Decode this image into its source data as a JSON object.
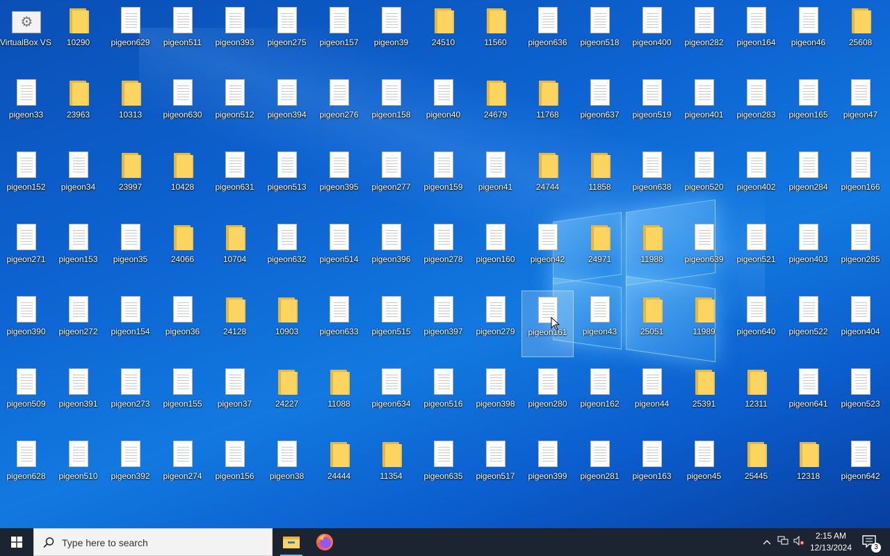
{
  "desktop": {
    "columns": [
      {
        "items": [
          {
            "label": "VirtualBox VS Studio",
            "type": "settings"
          },
          {
            "label": "pigeon33",
            "type": "file"
          },
          {
            "label": "pigeon152",
            "type": "file"
          },
          {
            "label": "pigeon271",
            "type": "file"
          },
          {
            "label": "pigeon390",
            "type": "file"
          },
          {
            "label": "pigeon509",
            "type": "file"
          },
          {
            "label": "pigeon628",
            "type": "file"
          }
        ]
      },
      {
        "items": [
          {
            "label": "10290",
            "type": "folder"
          },
          {
            "label": "23963",
            "type": "folder"
          },
          {
            "label": "pigeon34",
            "type": "file"
          },
          {
            "label": "pigeon153",
            "type": "file"
          },
          {
            "label": "pigeon272",
            "type": "file"
          },
          {
            "label": "pigeon391",
            "type": "file"
          },
          {
            "label": "pigeon510",
            "type": "file"
          }
        ]
      },
      {
        "items": [
          {
            "label": "pigeon629",
            "type": "file"
          },
          {
            "label": "10313",
            "type": "folder"
          },
          {
            "label": "23997",
            "type": "folder"
          },
          {
            "label": "pigeon35",
            "type": "file"
          },
          {
            "label": "pigeon154",
            "type": "file"
          },
          {
            "label": "pigeon273",
            "type": "file"
          },
          {
            "label": "pigeon392",
            "type": "file"
          }
        ]
      },
      {
        "items": [
          {
            "label": "pigeon511",
            "type": "file"
          },
          {
            "label": "pigeon630",
            "type": "file"
          },
          {
            "label": "10428",
            "type": "folder"
          },
          {
            "label": "24066",
            "type": "folder"
          },
          {
            "label": "pigeon36",
            "type": "file"
          },
          {
            "label": "pigeon155",
            "type": "file"
          },
          {
            "label": "pigeon274",
            "type": "file"
          }
        ]
      },
      {
        "items": [
          {
            "label": "pigeon393",
            "type": "file"
          },
          {
            "label": "pigeon512",
            "type": "file"
          },
          {
            "label": "pigeon631",
            "type": "file"
          },
          {
            "label": "10704",
            "type": "folder"
          },
          {
            "label": "24128",
            "type": "folder"
          },
          {
            "label": "pigeon37",
            "type": "file"
          },
          {
            "label": "pigeon156",
            "type": "file"
          }
        ]
      },
      {
        "items": [
          {
            "label": "pigeon275",
            "type": "file"
          },
          {
            "label": "pigeon394",
            "type": "file"
          },
          {
            "label": "pigeon513",
            "type": "file"
          },
          {
            "label": "pigeon632",
            "type": "file"
          },
          {
            "label": "10903",
            "type": "folder"
          },
          {
            "label": "24227",
            "type": "folder"
          },
          {
            "label": "pigeon38",
            "type": "file"
          }
        ]
      },
      {
        "items": [
          {
            "label": "pigeon157",
            "type": "file"
          },
          {
            "label": "pigeon276",
            "type": "file"
          },
          {
            "label": "pigeon395",
            "type": "file"
          },
          {
            "label": "pigeon514",
            "type": "file"
          },
          {
            "label": "pigeon633",
            "type": "file"
          },
          {
            "label": "11088",
            "type": "folder"
          },
          {
            "label": "24444",
            "type": "folder"
          }
        ]
      },
      {
        "items": [
          {
            "label": "pigeon39",
            "type": "file"
          },
          {
            "label": "pigeon158",
            "type": "file"
          },
          {
            "label": "pigeon277",
            "type": "file"
          },
          {
            "label": "pigeon396",
            "type": "file"
          },
          {
            "label": "pigeon515",
            "type": "file"
          },
          {
            "label": "pigeon634",
            "type": "file"
          },
          {
            "label": "11354",
            "type": "folder"
          }
        ]
      },
      {
        "items": [
          {
            "label": "24510",
            "type": "folder"
          },
          {
            "label": "pigeon40",
            "type": "file"
          },
          {
            "label": "pigeon159",
            "type": "file"
          },
          {
            "label": "pigeon278",
            "type": "file"
          },
          {
            "label": "pigeon397",
            "type": "file"
          },
          {
            "label": "pigeon516",
            "type": "file"
          },
          {
            "label": "pigeon635",
            "type": "file"
          }
        ]
      },
      {
        "items": [
          {
            "label": "11560",
            "type": "folder"
          },
          {
            "label": "24679",
            "type": "folder"
          },
          {
            "label": "pigeon41",
            "type": "file"
          },
          {
            "label": "pigeon160",
            "type": "file"
          },
          {
            "label": "pigeon279",
            "type": "file"
          },
          {
            "label": "pigeon398",
            "type": "file"
          },
          {
            "label": "pigeon517",
            "type": "file"
          }
        ]
      },
      {
        "items": [
          {
            "label": "pigeon636",
            "type": "file"
          },
          {
            "label": "11768",
            "type": "folder"
          },
          {
            "label": "24744",
            "type": "folder"
          },
          {
            "label": "pigeon42",
            "type": "file"
          },
          {
            "label": "pigeon161",
            "type": "file",
            "selected": true
          },
          {
            "label": "pigeon280",
            "type": "file"
          },
          {
            "label": "pigeon399",
            "type": "file"
          }
        ]
      },
      {
        "items": [
          {
            "label": "pigeon518",
            "type": "file"
          },
          {
            "label": "pigeon637",
            "type": "file"
          },
          {
            "label": "11858",
            "type": "folder"
          },
          {
            "label": "24971",
            "type": "folder"
          },
          {
            "label": "pigeon43",
            "type": "file"
          },
          {
            "label": "pigeon162",
            "type": "file"
          },
          {
            "label": "pigeon281",
            "type": "file"
          }
        ]
      },
      {
        "items": [
          {
            "label": "pigeon400",
            "type": "file"
          },
          {
            "label": "pigeon519",
            "type": "file"
          },
          {
            "label": "pigeon638",
            "type": "file"
          },
          {
            "label": "11988",
            "type": "folder"
          },
          {
            "label": "25051",
            "type": "folder"
          },
          {
            "label": "pigeon44",
            "type": "file"
          },
          {
            "label": "pigeon163",
            "type": "file"
          }
        ]
      },
      {
        "items": [
          {
            "label": "pigeon282",
            "type": "file"
          },
          {
            "label": "pigeon401",
            "type": "file"
          },
          {
            "label": "pigeon520",
            "type": "file"
          },
          {
            "label": "pigeon639",
            "type": "file"
          },
          {
            "label": "11989",
            "type": "folder"
          },
          {
            "label": "25391",
            "type": "folder"
          },
          {
            "label": "pigeon45",
            "type": "file"
          }
        ]
      },
      {
        "items": [
          {
            "label": "pigeon164",
            "type": "file"
          },
          {
            "label": "pigeon283",
            "type": "file"
          },
          {
            "label": "pigeon402",
            "type": "file"
          },
          {
            "label": "pigeon521",
            "type": "file"
          },
          {
            "label": "pigeon640",
            "type": "file"
          },
          {
            "label": "12311",
            "type": "folder"
          },
          {
            "label": "25445",
            "type": "folder"
          }
        ]
      },
      {
        "items": [
          {
            "label": "pigeon46",
            "type": "file"
          },
          {
            "label": "pigeon165",
            "type": "file"
          },
          {
            "label": "pigeon284",
            "type": "file"
          },
          {
            "label": "pigeon403",
            "type": "file"
          },
          {
            "label": "pigeon522",
            "type": "file"
          },
          {
            "label": "pigeon641",
            "type": "file"
          },
          {
            "label": "12318",
            "type": "folder"
          }
        ]
      },
      {
        "items": [
          {
            "label": "25608",
            "type": "folder"
          },
          {
            "label": "pigeon47",
            "type": "file"
          },
          {
            "label": "pigeon166",
            "type": "file"
          },
          {
            "label": "pigeon285",
            "type": "file"
          },
          {
            "label": "pigeon404",
            "type": "file"
          },
          {
            "label": "pigeon523",
            "type": "file"
          },
          {
            "label": "pigeon642",
            "type": "file"
          }
        ]
      }
    ]
  },
  "taskbar": {
    "search_placeholder": "Type here to search",
    "apps": [
      {
        "name": "file-explorer",
        "icon": "folder-icon"
      },
      {
        "name": "firefox",
        "icon": "firefox-icon"
      }
    ],
    "clock": {
      "time": "2:15 AM",
      "date": "12/13/2024"
    },
    "notification_count": "3"
  },
  "colors": {
    "desktop_bg": "#0d63d1",
    "taskbar_bg": "#1b2430",
    "folder_yellow": "#fcd460"
  }
}
